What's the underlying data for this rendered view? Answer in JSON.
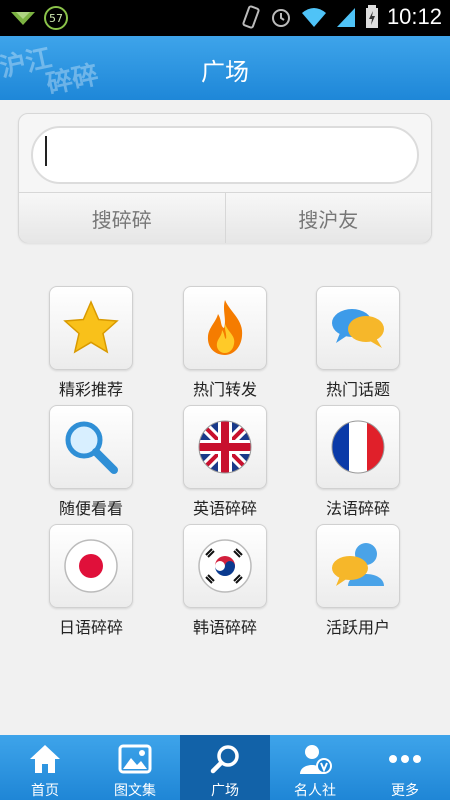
{
  "status_bar": {
    "badge": "57",
    "time": "10:12"
  },
  "header": {
    "logo_line1": "沪江",
    "logo_line2": "碎碎",
    "title": "广场"
  },
  "search": {
    "input_value": "",
    "buttons": [
      {
        "label": "搜碎碎"
      },
      {
        "label": "搜沪友"
      }
    ]
  },
  "grid": {
    "items": [
      {
        "label": "精彩推荐",
        "icon": "star-icon"
      },
      {
        "label": "热门转发",
        "icon": "flame-icon"
      },
      {
        "label": "热门话题",
        "icon": "chat-bubbles-icon"
      },
      {
        "label": "随便看看",
        "icon": "magnifier-icon"
      },
      {
        "label": "英语碎碎",
        "icon": "uk-flag-icon"
      },
      {
        "label": "法语碎碎",
        "icon": "france-flag-icon"
      },
      {
        "label": "日语碎碎",
        "icon": "japan-flag-icon"
      },
      {
        "label": "韩语碎碎",
        "icon": "korea-flag-icon"
      },
      {
        "label": "活跃用户",
        "icon": "active-users-icon"
      }
    ]
  },
  "bottom_nav": {
    "active_index": 2,
    "items": [
      {
        "label": "首页",
        "icon": "home-icon"
      },
      {
        "label": "图文集",
        "icon": "image-icon"
      },
      {
        "label": "广场",
        "icon": "search-icon"
      },
      {
        "label": "名人社",
        "icon": "vip-user-icon"
      },
      {
        "label": "更多",
        "icon": "more-dots-icon"
      }
    ]
  },
  "colors": {
    "header_blue": "#2a95e1",
    "nav_active": "#1262a8"
  }
}
